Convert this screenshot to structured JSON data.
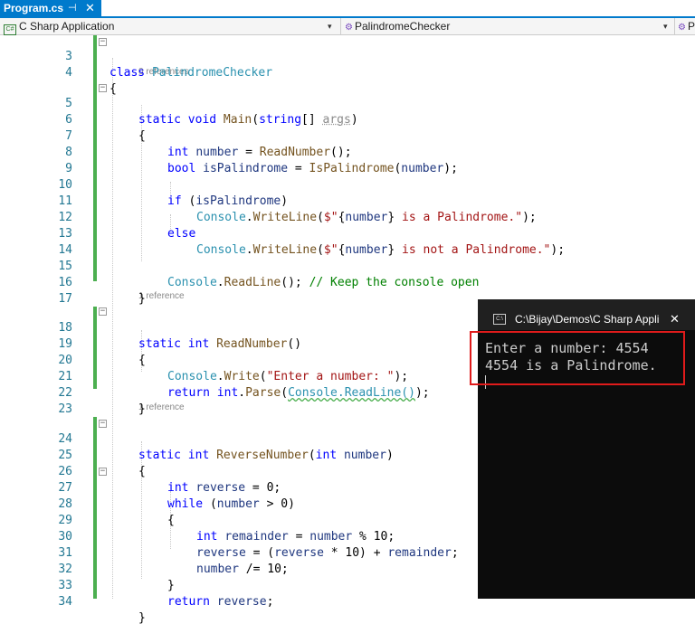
{
  "tab": {
    "title": "Program.cs",
    "pin": "⊣",
    "close": "✕"
  },
  "nav": {
    "project": "C Sharp Application",
    "class": "PalindromeChecker",
    "member": "PalindromeChecker"
  },
  "codelens": {
    "ref0": "0 references",
    "ref1": "1 reference",
    "ref2": "1 reference"
  },
  "code": {
    "l3": {
      "n": "3",
      "a": "class ",
      "b": "PalindromeChecker"
    },
    "l4": {
      "n": "4",
      "a": "{"
    },
    "l5": {
      "n": "5",
      "a": "static void ",
      "b": "Main",
      "c": "(",
      "d": "string",
      "e": "[] ",
      "f": "args",
      "g": ")"
    },
    "l6": {
      "n": "6",
      "a": "{"
    },
    "l7": {
      "n": "7",
      "a": "int ",
      "b": "number",
      "c": " = ",
      "d": "ReadNumber",
      "e": "();"
    },
    "l8": {
      "n": "8",
      "a": "bool ",
      "b": "isPalindrome",
      "c": " = ",
      "d": "IsPalindrome",
      "e": "(",
      "f": "number",
      "g": ");"
    },
    "l9": {
      "n": "9"
    },
    "l10": {
      "n": "10",
      "a": "if ",
      "b": "(",
      "c": "isPalindrome",
      "d": ")"
    },
    "l11": {
      "n": "11",
      "a": "Console",
      "b": ".",
      "c": "WriteLine",
      "d": "(",
      "e": "$\"",
      "f": "{",
      "g": "number",
      "h": "}",
      "i": " is a Palindrome.\"",
      "j": ");"
    },
    "l12": {
      "n": "12",
      "a": "else"
    },
    "l13": {
      "n": "13",
      "a": "Console",
      "b": ".",
      "c": "WriteLine",
      "d": "(",
      "e": "$\"",
      "f": "{",
      "g": "number",
      "h": "}",
      "i": " is not a Palindrome.\"",
      "j": ");"
    },
    "l14": {
      "n": "14"
    },
    "l15": {
      "n": "15",
      "a": "Console",
      "b": ".",
      "c": "ReadLine",
      "d": "(); ",
      "e": "// Keep the console open"
    },
    "l16": {
      "n": "16",
      "a": "}"
    },
    "l17": {
      "n": "17"
    },
    "l18": {
      "n": "18",
      "a": "static int ",
      "b": "ReadNumber",
      "c": "()"
    },
    "l19": {
      "n": "19",
      "a": "{"
    },
    "l20": {
      "n": "20",
      "a": "Console",
      "b": ".",
      "c": "Write",
      "d": "(",
      "e": "\"Enter a number: \"",
      "f": ");"
    },
    "l21": {
      "n": "21",
      "a": "return ",
      "b": "int",
      "c": ".",
      "d": "Parse",
      "e": "(",
      "f": "Console.ReadLine()",
      "g": ");"
    },
    "l22": {
      "n": "22",
      "a": "}"
    },
    "l23": {
      "n": "23"
    },
    "l24": {
      "n": "24",
      "a": "static int ",
      "b": "ReverseNumber",
      "c": "(",
      "d": "int ",
      "e": "number",
      "f": ")"
    },
    "l25": {
      "n": "25",
      "a": "{"
    },
    "l26": {
      "n": "26",
      "a": "int ",
      "b": "reverse",
      "c": " = 0;"
    },
    "l27": {
      "n": "27",
      "a": "while ",
      "b": "(",
      "c": "number",
      "d": " > 0)"
    },
    "l28": {
      "n": "28",
      "a": "{"
    },
    "l29": {
      "n": "29",
      "a": "int ",
      "b": "remainder",
      "c": " = ",
      "d": "number",
      "e": " % 10;"
    },
    "l30": {
      "n": "30",
      "a": "reverse",
      "b": " = (",
      "c": "reverse",
      "d": " * 10) + ",
      "e": "remainder",
      "f": ";"
    },
    "l31": {
      "n": "31",
      "a": "number",
      "b": " /= 10;"
    },
    "l32": {
      "n": "32",
      "a": "}"
    },
    "l33": {
      "n": "33",
      "a": "return ",
      "b": "reverse",
      "c": ";"
    },
    "l34": {
      "n": "34",
      "a": "}"
    }
  },
  "console": {
    "title": "C:\\Bijay\\Demos\\C Sharp Appli",
    "close": "✕",
    "line1": "Enter a number: 4554",
    "line2": "4554 is a Palindrome."
  }
}
